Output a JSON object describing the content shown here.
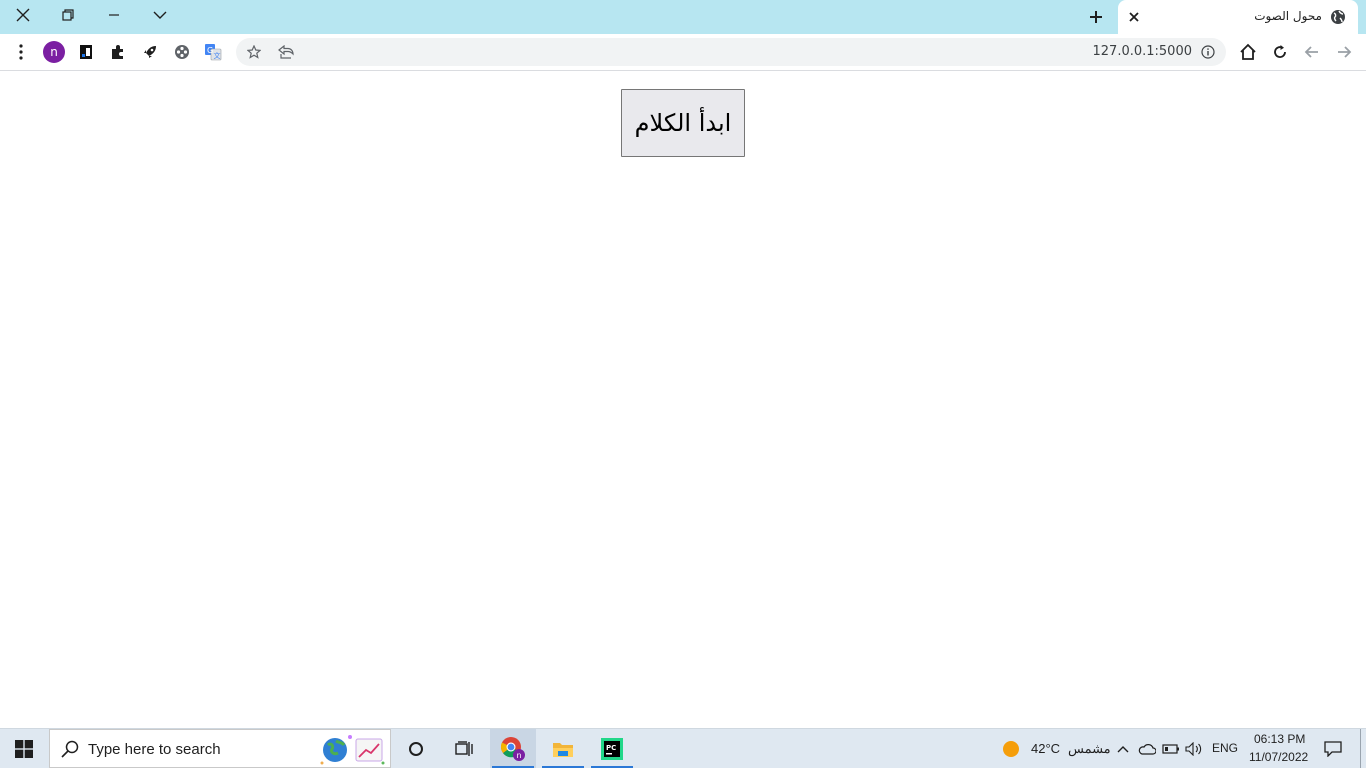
{
  "window": {
    "close_icon": "close-icon",
    "restore_icon": "restore-icon",
    "minimize_icon": "minimize-icon",
    "tab_search_icon": "chevron-down-icon"
  },
  "tab": {
    "title": "محول الصوت",
    "favicon": "globe-icon",
    "close_icon": "close-icon"
  },
  "new_tab_icon": "plus-icon",
  "toolbar": {
    "menu_icon": "kebab-menu-icon",
    "profile_initial": "n",
    "extension_icons": [
      "reader-icon",
      "puzzle-icon",
      "rocket-icon",
      "film-icon",
      "translate-icon"
    ],
    "bookmark_icon": "star-icon",
    "share_icon": "share-icon",
    "url": "127.0.0.1:5000",
    "site_info_icon": "info-icon",
    "home_icon": "home-icon",
    "reload_icon": "reload-icon",
    "back_icon": "arrow-left-icon",
    "forward_icon": "arrow-right-icon"
  },
  "page": {
    "start_button_label": "ابدأ الكلام"
  },
  "taskbar": {
    "search_placeholder": "Type here to search",
    "weather_temp": "42°C",
    "weather_condition": "مشمس",
    "language": "ENG",
    "time": "06:13 PM",
    "date": "11/07/2022",
    "apps": [
      "cortana-icon",
      "task-view-icon",
      "chrome-icon",
      "file-explorer-icon",
      "pycharm-icon"
    ]
  },
  "colors": {
    "tabstrip_bg": "#b7e6f1",
    "profile_avatar": "#7b1fa2",
    "taskbar_bg": "#dfe8f1",
    "taskbar_active_underline": "#2b78d6"
  }
}
